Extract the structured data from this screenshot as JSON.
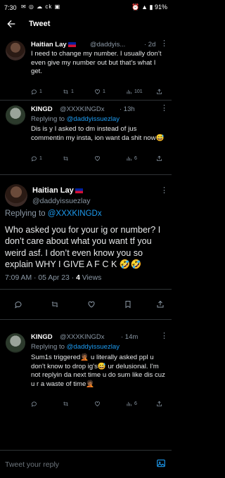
{
  "status_bar": {
    "time": "7:30",
    "icons_left": "✉ ◎ ☁ ck ▣",
    "right": "⏰ ▲ ▮ 91%",
    "battery": "91%"
  },
  "nav": {
    "title": "Tweet"
  },
  "tweets": [
    {
      "name": "Haitian Lay",
      "handle": "@daddyis...",
      "time": "· 2d",
      "text": "I need to change my number. I usually don’t even give my number out but that’s what I get.",
      "replies": "1",
      "retweets": "1",
      "likes": "1",
      "views": "101"
    },
    {
      "name": "KINGD",
      "handle": "@XXXKINGDx",
      "time": "· 13h",
      "reply_prefix": "Replying to",
      "reply_to": "@daddyissuezlay",
      "text": "Dis is y I asked to dm instead of jus commentin my insta, ion want da shit now😅",
      "replies": "1",
      "retweets": "",
      "likes": "",
      "views": "6"
    }
  ],
  "main_tweet": {
    "name": "Haitian Lay",
    "handle": "@daddyissuezlay",
    "reply_prefix": "Replying to",
    "reply_to": "@XXXKINGDx",
    "text": "Who asked you for your ig or number? I don’t care about what you want tf you weird asf. I don’t even know you so explain WHY I GIVE A F C K 🤣🤣",
    "timestamp": "7:09 AM · 05 Apr 23 · ",
    "views_count": "4",
    "views_label": "Views"
  },
  "reply_tweet": {
    "name": "KINGD",
    "handle": "@XXXKINGDx",
    "time": "· 14m",
    "reply_prefix": "Replying to",
    "reply_to": "@daddyissuezlay",
    "text": "Sum1s triggered🤦🏾 u literally asked ppl u don't know to drop ig's😅 ur delusional. I'm not replyin da next time u do sum like dis cuz u r a waste of time🤦🏾",
    "replies": "",
    "retweets": "",
    "likes": "",
    "views": "6"
  },
  "reply_bar": {
    "placeholder": "Tweet your reply"
  },
  "colors": {
    "accent": "#1d9bf0",
    "secondary_text": "#8b98a5",
    "background": "#000000"
  }
}
